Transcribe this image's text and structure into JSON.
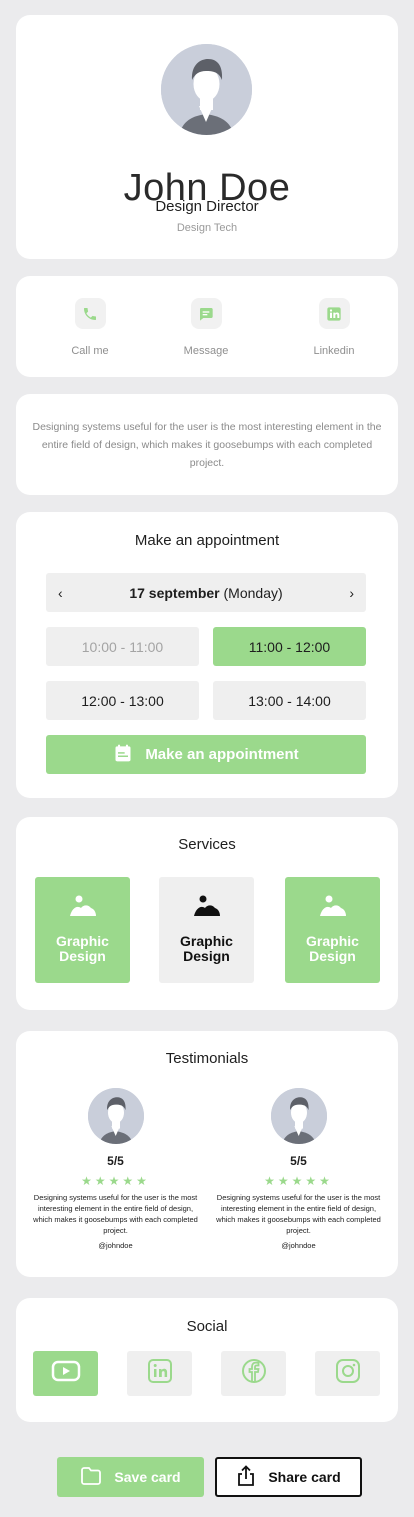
{
  "profile": {
    "name": "John Doe",
    "role": "Design Director",
    "company": "Design Tech"
  },
  "contacts": [
    {
      "label": "Call me",
      "icon": "phone-icon"
    },
    {
      "label": "Message",
      "icon": "message-icon"
    },
    {
      "label": "Linkedin",
      "icon": "linkedin-icon"
    }
  ],
  "bio": "Designing systems useful for the user is the most interesting element in the entire field of design, which makes it goosebumps with each completed project.",
  "appointment": {
    "title": "Make an appointment",
    "date": "17 september",
    "weekday": "(Monday)",
    "prev": "‹",
    "next": "›",
    "slots": [
      "10:00 - 11:00",
      "11:00 - 12:00",
      "12:00 - 13:00",
      "13:00 - 14:00"
    ],
    "selected_slot": "11:00 - 12:00",
    "button": "Make an appointment"
  },
  "services": {
    "title": "Services",
    "items": [
      "Graphic\nDesign",
      "Graphic\nDesign",
      "Graphic\nDesign"
    ]
  },
  "testimonials": {
    "title": "Testimonials",
    "items": [
      {
        "score": "5/5",
        "stars": "★★★★★",
        "text": "Designing systems useful for the user is the most interesting element in the entire field of design, which makes it goosebumps with each completed project.",
        "handle": "@johndoe"
      },
      {
        "score": "5/5",
        "stars": "★★★★★",
        "text": "Designing systems useful for the user is the most interesting element in the entire field of design, which makes it goosebumps with each completed project.",
        "handle": "@johndoe"
      }
    ]
  },
  "social": {
    "title": "Social",
    "items": [
      "youtube-icon",
      "linkedin-icon",
      "facebook-icon",
      "instagram-icon"
    ]
  },
  "actions": {
    "save": "Save card",
    "share": "Share card"
  },
  "colors": {
    "accent": "#9bd98c",
    "background": "#ebebed",
    "tile": "#efefef",
    "avatar": "#c9ceda"
  }
}
